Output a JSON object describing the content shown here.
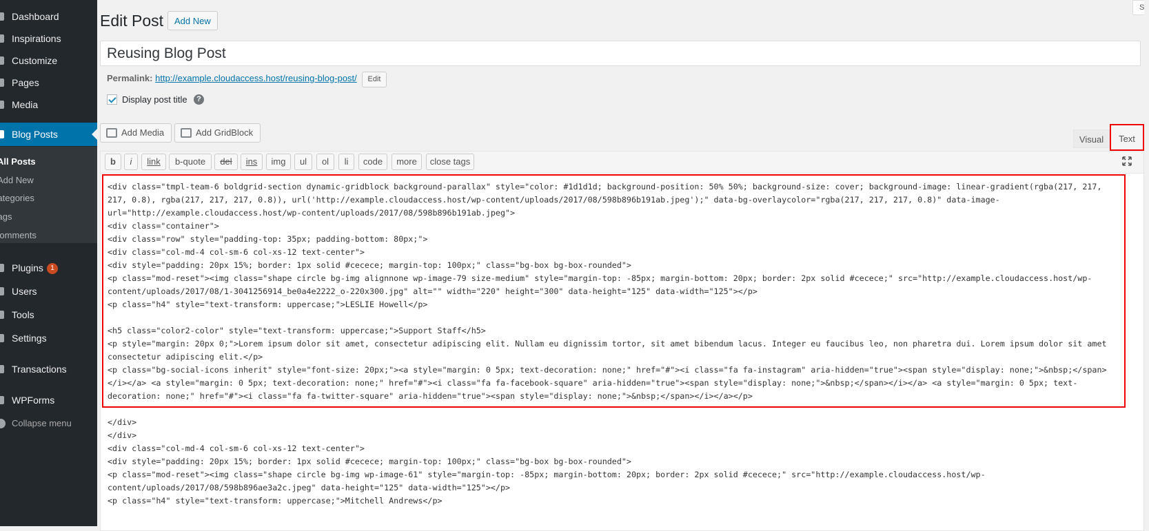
{
  "sidebar": {
    "items": [
      {
        "label": "Dashboard",
        "icon": "dashboard-icon"
      },
      {
        "label": "Inspirations",
        "icon": "lightbulb-icon"
      },
      {
        "label": "Customize",
        "icon": "brush-icon"
      },
      {
        "label": "Pages",
        "icon": "page-icon"
      },
      {
        "label": "Media",
        "icon": "media-icon"
      },
      {
        "label": "Blog Posts",
        "icon": "pin-icon"
      },
      {
        "label": "Plugins",
        "icon": "plug-icon",
        "badge": "1"
      },
      {
        "label": "Users",
        "icon": "users-icon"
      },
      {
        "label": "Tools",
        "icon": "wrench-icon"
      },
      {
        "label": "Settings",
        "icon": "settings-icon"
      },
      {
        "label": "Transactions",
        "icon": "transactions-icon"
      },
      {
        "label": "WPForms",
        "icon": "forms-icon"
      },
      {
        "label": "Collapse menu",
        "icon": "collapse-icon"
      }
    ],
    "submenu": [
      "All Posts",
      "Add New",
      "Categories",
      "Tags",
      "Comments"
    ]
  },
  "header": {
    "title": "Edit Post",
    "add_new": "Add New"
  },
  "post": {
    "title": "Reusing Blog Post",
    "permalink_label": "Permalink:",
    "permalink_base": "http://example.cloudaccess.host/",
    "permalink_slug": "reusing-blog-post/",
    "edit_label": "Edit",
    "display_title_label": "Display post title",
    "help": "?"
  },
  "media": {
    "add_media": "Add Media",
    "add_gridblock": "Add GridBlock"
  },
  "tabs": {
    "visual": "Visual",
    "text": "Text"
  },
  "quicktags": [
    "b",
    "i",
    "link",
    "b-quote",
    "del",
    "ins",
    "img",
    "ul",
    "ol",
    "li",
    "code",
    "more",
    "close tags"
  ],
  "editor": {
    "lines": [
      "<div class=\"tmpl-team-6 boldgrid-section dynamic-gridblock background-parallax\" style=\"color: #1d1d1d; background-position: 50% 50%; background-size: cover; background-image: linear-gradient(rgba(217, 217,",
      "217, 0.8), rgba(217, 217, 217, 0.8)), url('http://example.cloudaccess.host/wp-content/uploads/2017/08/598b896b191ab.jpeg');\" data-bg-overlaycolor=\"rgba(217, 217, 217, 0.8)\" data-image-",
      "url=\"http://example.cloudaccess.host/wp-content/uploads/2017/08/598b896b191ab.jpeg\">",
      "<div class=\"container\">",
      "<div class=\"row\" style=\"padding-top: 35px; padding-bottom: 80px;\">",
      "<div class=\"col-md-4 col-sm-6 col-xs-12 text-center\">",
      "<div style=\"padding: 20px 15%; border: 1px solid #cecece; margin-top: 100px;\" class=\"bg-box bg-box-rounded\">",
      "<p class=\"mod-reset\"><img class=\"shape circle bg-img alignnone wp-image-79 size-medium\" style=\"margin-top: -85px; margin-bottom: 20px; border: 2px solid #cecece;\" src=\"http://example.cloudaccess.host/wp-",
      "content/uploads/2017/08/1-3041256914_be0a4e2222_o-220x300.jpg\" alt=\"\" width=\"220\" height=\"300\" data-height=\"125\" data-width=\"125\"></p>",
      "<p class=\"h4\" style=\"text-transform: uppercase;\">LESLIE Howell</p>",
      "",
      "<h5 class=\"color2-color\" style=\"text-transform: uppercase;\">Support Staff</h5>",
      "<p style=\"margin: 20px 0;\">Lorem ipsum dolor sit amet, consectetur adipiscing elit. Nullam eu dignissim tortor, sit amet bibendum lacus. Integer eu faucibus leo, non pharetra dui. Lorem ipsum dolor sit amet",
      "consectetur adipiscing elit.</p>",
      "<p class=\"bg-social-icons inherit\" style=\"font-size: 20px;\"><a style=\"margin: 0 5px; text-decoration: none;\" href=\"#\"><i class=\"fa fa-instagram\" aria-hidden=\"true\"><span style=\"display: none;\">&nbsp;</span>",
      "</i></a> <a style=\"margin: 0 5px; text-decoration: none;\" href=\"#\"><i class=\"fa fa-facebook-square\" aria-hidden=\"true\"><span style=\"display: none;\">&nbsp;</span></i></a> <a style=\"margin: 0 5px; text-",
      "decoration: none;\" href=\"#\"><i class=\"fa fa-twitter-square\" aria-hidden=\"true\"><span style=\"display: none;\">&nbsp;</span></i></a></p>",
      "",
      "</div>",
      "</div>",
      "<div class=\"col-md-4 col-sm-6 col-xs-12 text-center\">",
      "<div style=\"padding: 20px 15%; border: 1px solid #cecece; margin-top: 100px;\" class=\"bg-box bg-box-rounded\">",
      "<p class=\"mod-reset\"><img class=\"shape circle bg-img wp-image-61\" style=\"margin-top: -85px; margin-bottom: 20px; border: 2px solid #cecece;\" src=\"http://example.cloudaccess.host/wp-",
      "content/uploads/2017/08/598b896ae3a2c.jpeg\" data-height=\"125\" data-width=\"125\"></p>",
      "<p class=\"h4\" style=\"text-transform: uppercase;\">Mitchell Andrews</p>"
    ]
  },
  "colors": {
    "sidebar_bg": "#23282d",
    "active": "#0073aa",
    "highlight": "#e00",
    "badge": "#ca4a1f"
  }
}
